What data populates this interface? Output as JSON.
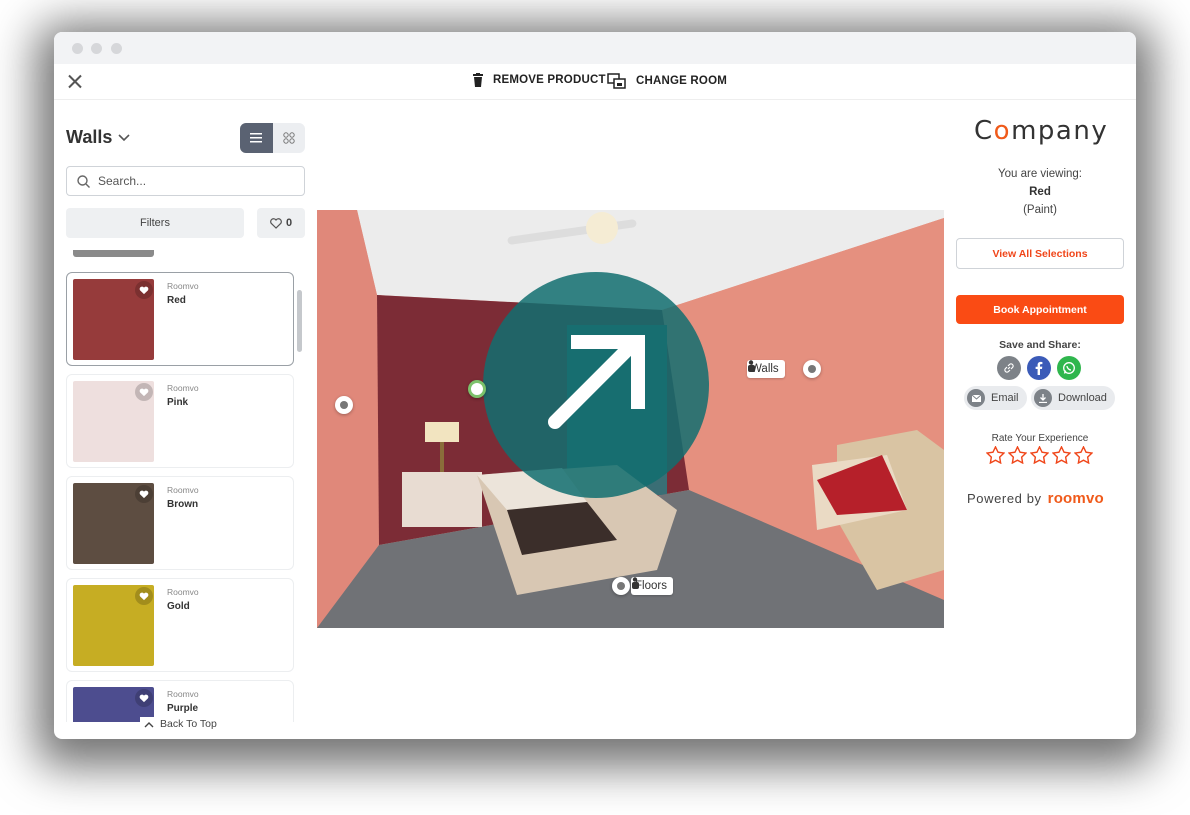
{
  "toolbar": {
    "remove_label": "REMOVE PRODUCT",
    "change_room_label": "CHANGE ROOM"
  },
  "left_panel": {
    "category": "Walls",
    "search_placeholder": "Search...",
    "filters_label": "Filters",
    "favorites_count": "0",
    "back_to_top": "Back To Top",
    "products": [
      {
        "brand": "Roomvo",
        "name": "Red",
        "color": "#963b3b",
        "selected": true
      },
      {
        "brand": "Roomvo",
        "name": "Pink",
        "color": "#eedfde",
        "selected": false
      },
      {
        "brand": "Roomvo",
        "name": "Brown",
        "color": "#5d4d41",
        "selected": false
      },
      {
        "brand": "Roomvo",
        "name": "Gold",
        "color": "#c6ad23",
        "selected": false
      },
      {
        "brand": "Roomvo",
        "name": "Purple",
        "color": "#4d4d8f",
        "selected": false
      }
    ]
  },
  "room": {
    "walls_label": "Walls",
    "floors_label": "Floors",
    "wall_color": "#e5907f",
    "accent_wall_color": "#7c2c36"
  },
  "right_panel": {
    "logo_c": "C",
    "logo_o": "o",
    "logo_rest": "mpany",
    "viewing_label": "You are viewing:",
    "product_name": "Red",
    "product_type": "(Paint)",
    "view_all_label": "View All Selections",
    "book_label": "Book Appointment",
    "share_title": "Save and Share:",
    "email_label": "Email",
    "download_label": "Download",
    "rate_title": "Rate Your Experience",
    "rating": 0,
    "powered_by": "Powered by",
    "powered_brand": "roomvo",
    "accent_color": "#fa4b14"
  }
}
